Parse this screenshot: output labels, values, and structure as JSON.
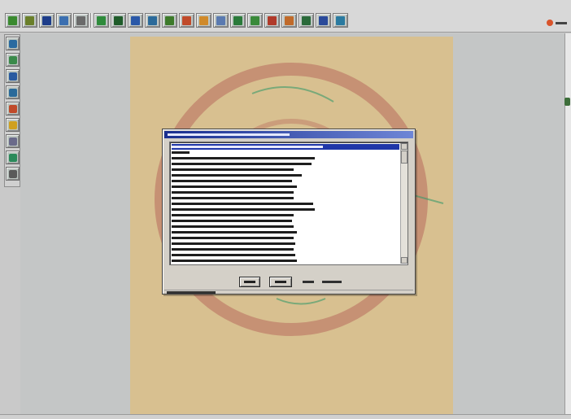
{
  "app": {
    "accent": "#1f36a8",
    "canvas_color": "#d8c090",
    "seal_color": "#b86a5c"
  },
  "toolbar": {
    "buttons": [
      {
        "icon": "leaf-icon",
        "color": "#3a8a2f"
      },
      {
        "icon": "chart-icon",
        "color": "#6a7f2a"
      },
      {
        "icon": "save-icon",
        "color": "#1d3d8a"
      },
      {
        "icon": "stats-icon",
        "color": "#3b6fb0"
      },
      {
        "icon": "table-icon",
        "color": "#6a6a6a"
      },
      {
        "icon": "exclamation-icon",
        "color": "#2e8b3b"
      },
      {
        "icon": "grid-icon",
        "color": "#1f5c2a"
      },
      {
        "icon": "ruler-icon",
        "color": "#2a58a8"
      },
      {
        "icon": "wave-icon",
        "color": "#2b6a9a"
      },
      {
        "icon": "map-icon",
        "color": "#3d7a2a"
      },
      {
        "icon": "layers-icon",
        "color": "#c04a2a"
      },
      {
        "icon": "pencil-icon",
        "color": "#d08a2a"
      },
      {
        "icon": "compass-icon",
        "color": "#5a7ab0"
      },
      {
        "icon": "tree-icon",
        "color": "#2a7a3a"
      },
      {
        "icon": "arrow-icon",
        "color": "#3a8a3a"
      },
      {
        "icon": "bar-chart-icon",
        "color": "#b03a2a"
      },
      {
        "icon": "bar-chart-icon",
        "color": "#c06a2a"
      },
      {
        "icon": "book-icon",
        "color": "#2a6a3a"
      },
      {
        "icon": "window-icon",
        "color": "#2a4a9a"
      },
      {
        "icon": "help-icon",
        "color": "#2a7aa0"
      }
    ]
  },
  "left_toolbar": {
    "buttons": [
      {
        "icon": "globe-icon",
        "color": "#2a6aa0"
      },
      {
        "icon": "picture-icon",
        "color": "#3a8a4a"
      },
      {
        "icon": "pen-icon",
        "color": "#2a5aa0"
      },
      {
        "icon": "pointer-icon",
        "color": "#2a6a9a"
      },
      {
        "icon": "zoom-icon",
        "color": "#c04a2a"
      },
      {
        "icon": "sun-icon",
        "color": "#d0a020"
      },
      {
        "icon": "spray-icon",
        "color": "#6a6a8a"
      },
      {
        "icon": "marker-icon",
        "color": "#2a8a5a"
      },
      {
        "icon": "print-icon",
        "color": "#5a5a5a"
      }
    ]
  },
  "dialog": {
    "list_rows": [
      {
        "selected": true,
        "width": 186
      },
      {
        "selected": false,
        "width": 22
      },
      {
        "selected": false,
        "width": 176
      },
      {
        "selected": false,
        "width": 172
      },
      {
        "selected": false,
        "width": 150
      },
      {
        "selected": false,
        "width": 160
      },
      {
        "selected": false,
        "width": 148
      },
      {
        "selected": false,
        "width": 154
      },
      {
        "selected": false,
        "width": 150
      },
      {
        "selected": false,
        "width": 150
      },
      {
        "selected": false,
        "width": 174
      },
      {
        "selected": false,
        "width": 176
      },
      {
        "selected": false,
        "width": 150
      },
      {
        "selected": false,
        "width": 148
      },
      {
        "selected": false,
        "width": 150
      },
      {
        "selected": false,
        "width": 154
      },
      {
        "selected": false,
        "width": 150
      },
      {
        "selected": false,
        "width": 152
      },
      {
        "selected": false,
        "width": 150
      },
      {
        "selected": false,
        "width": 152
      },
      {
        "selected": false,
        "width": 154
      }
    ]
  }
}
